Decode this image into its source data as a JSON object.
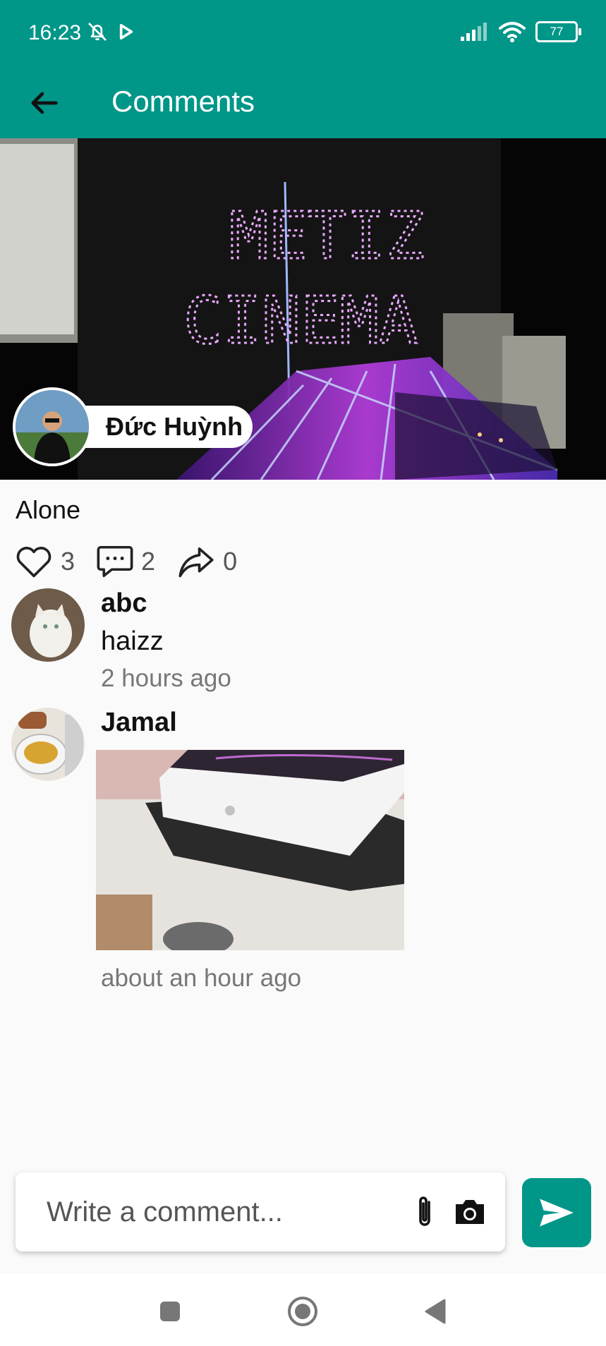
{
  "status": {
    "time": "16:23",
    "battery": "77"
  },
  "header": {
    "title": "Comments"
  },
  "post": {
    "author_name": "Đức Huỳnh",
    "caption": "Alone",
    "likes": "3",
    "comments": "2",
    "shares": "0",
    "image_sign_line1": "METIZ",
    "image_sign_line2": "CINEMA"
  },
  "comments": [
    {
      "name": "abc",
      "text": "haizz",
      "time": "2 hours ago"
    },
    {
      "name": "Jamal",
      "time": "about an hour ago"
    }
  ],
  "composer": {
    "placeholder": "Write a comment..."
  },
  "colors": {
    "primary": "#009688",
    "background": "#fafafa"
  },
  "icons": {
    "back": "arrow-left-icon",
    "like": "heart-outline-icon",
    "comment": "speech-bubble-icon",
    "share": "share-arrow-icon",
    "attach": "paperclip-icon",
    "camera": "camera-icon",
    "send": "send-icon"
  }
}
